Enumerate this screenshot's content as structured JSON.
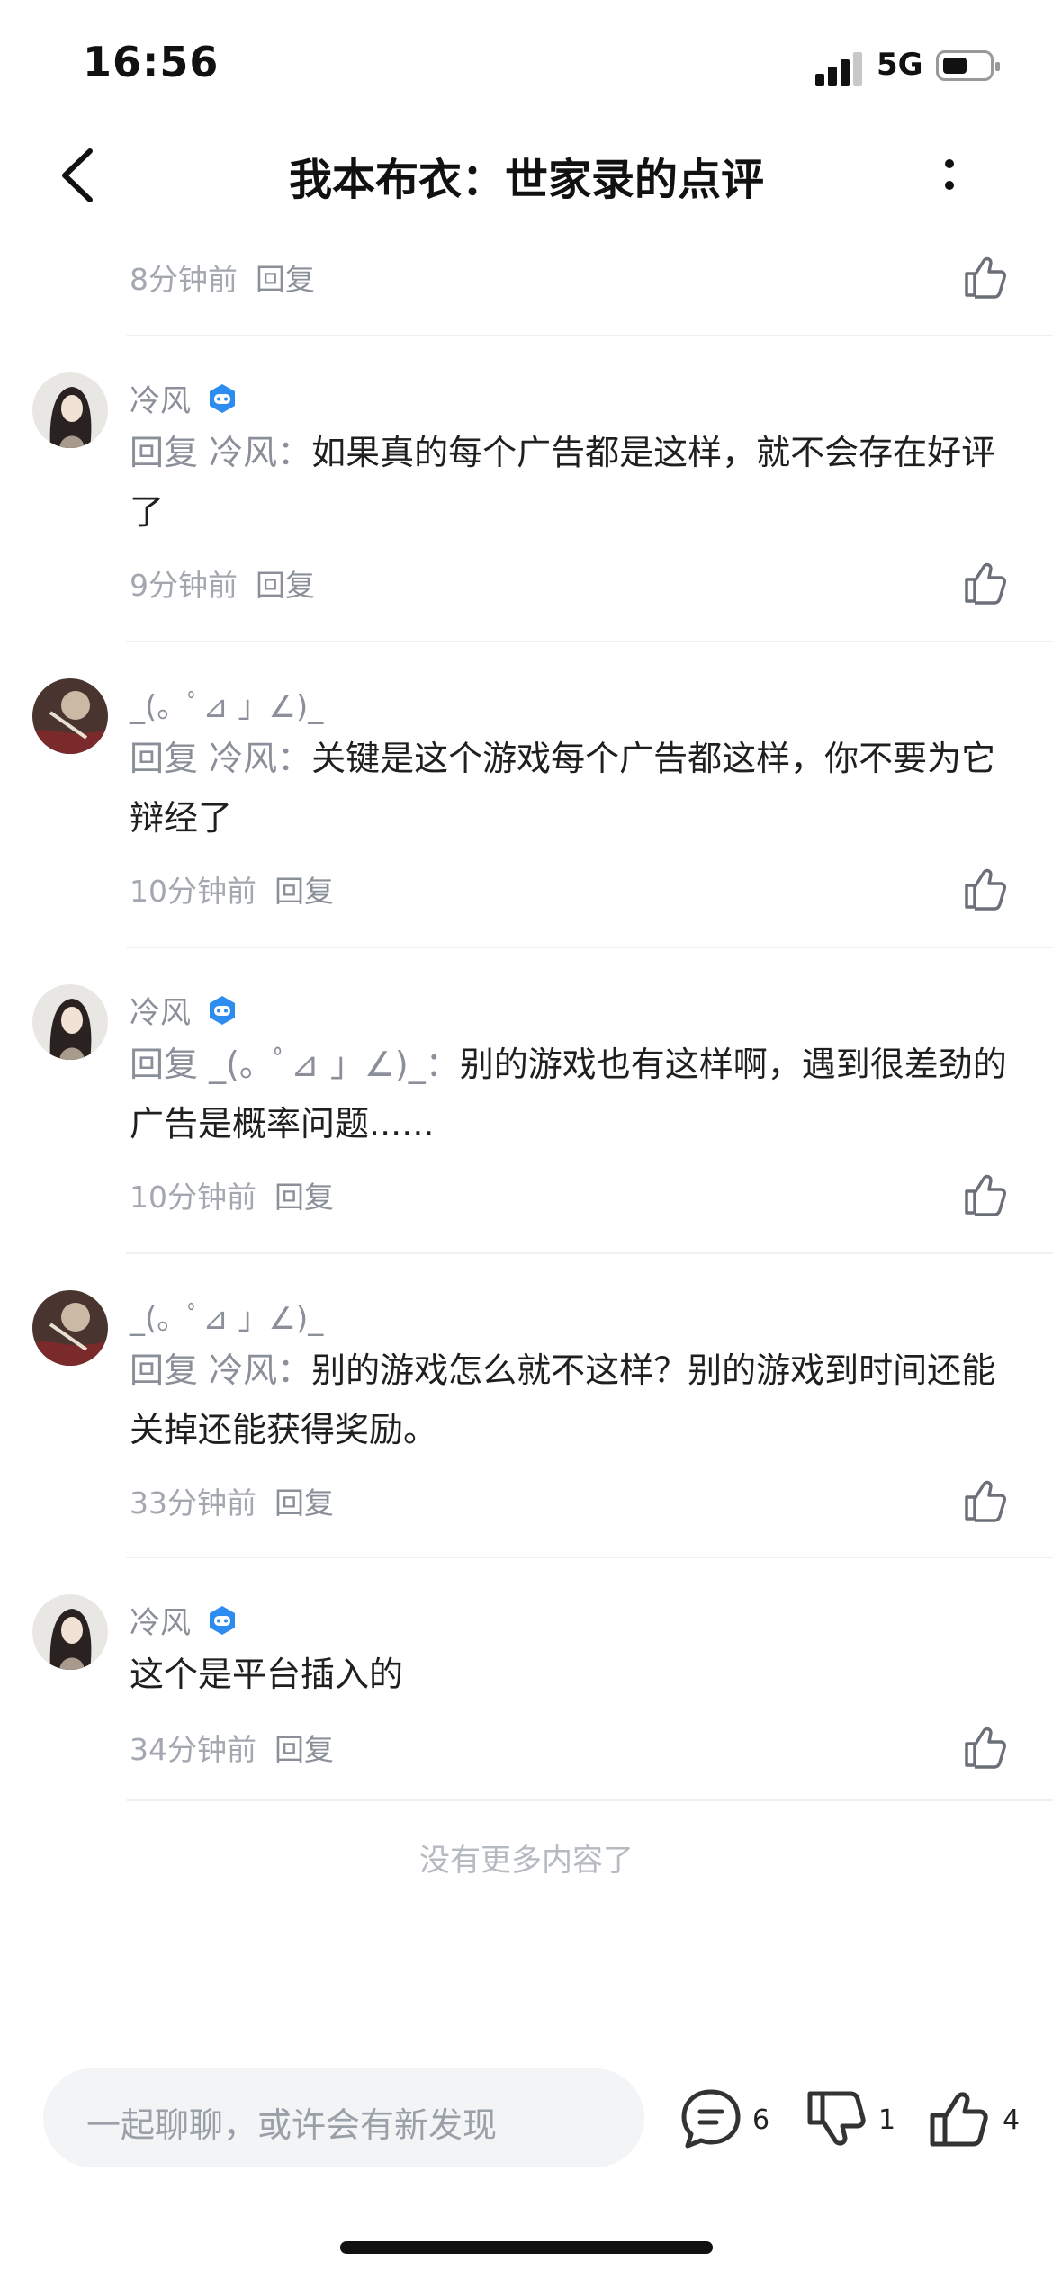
{
  "status": {
    "time": "16:56",
    "network": "5G"
  },
  "nav": {
    "title": "我本布衣：世家录的点评"
  },
  "first_meta": {
    "time": "8分钟前",
    "reply": "回复"
  },
  "comments": [
    {
      "user": "冷风",
      "prefix": "回复 冷风：",
      "text": "如果真的每个广告都是这样，就不会存在好评了",
      "time": "9分钟前",
      "reply": "回复"
    },
    {
      "user": "_(。ﾟ⊿ 」∠)_",
      "prefix": "回复 冷风：",
      "text": "关键是这个游戏每个广告都这样，你不要为它辩经了",
      "time": "10分钟前",
      "reply": "回复"
    },
    {
      "user": "冷风",
      "prefix": "回复 _(。ﾟ⊿ 」∠)_：",
      "text": "别的游戏也有这样啊，遇到很差劲的广告是概率问题......",
      "time": "10分钟前",
      "reply": "回复"
    },
    {
      "user": "_(。ﾟ⊿ 」∠)_",
      "prefix": "回复 冷风：",
      "text": "别的游戏怎么就不这样？别的游戏到时间还能关掉还能获得奖励。",
      "time": "33分钟前",
      "reply": "回复"
    },
    {
      "user": "冷风",
      "prefix": "",
      "text": "这个是平台插入的",
      "time": "34分钟前",
      "reply": "回复"
    }
  ],
  "footer": {
    "no_more": "没有更多内容了"
  },
  "bottom": {
    "input_placeholder": "一起聊聊，或许会有新发现",
    "comment_count": "6",
    "dislike_count": "1",
    "like_count": "4"
  },
  "colors": {
    "accent": "#2d8cf0",
    "muted": "#8a8f99"
  }
}
